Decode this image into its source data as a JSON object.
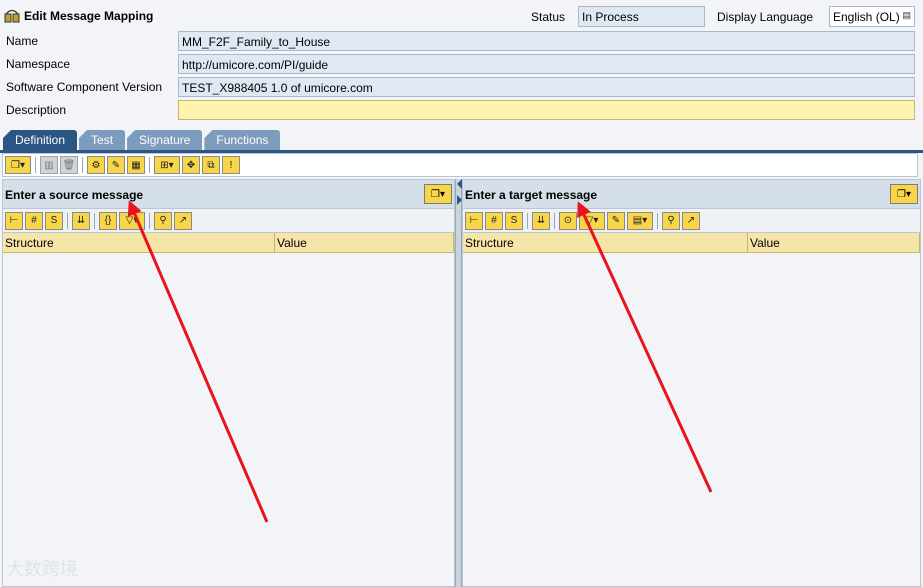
{
  "header": {
    "title": "Edit Message Mapping",
    "status_label": "Status",
    "status_value": "In Process",
    "language_label": "Display Language",
    "language_value": "English (OL)"
  },
  "fields": [
    {
      "label": "Name",
      "value": "MM_F2F_Family_to_House"
    },
    {
      "label": "Namespace",
      "value": "http://umicore.com/PI/guide"
    },
    {
      "label": "Software Component Version",
      "value": "TEST_X988405 1.0 of umicore.com"
    },
    {
      "label": "Description",
      "value": ""
    }
  ],
  "tabs": [
    {
      "label": "Definition",
      "active": true
    },
    {
      "label": "Test",
      "active": false
    },
    {
      "label": "Signature",
      "active": false
    },
    {
      "label": "Functions",
      "active": false
    }
  ],
  "source_pane": {
    "title": "Enter a source message",
    "columns": [
      "Structure",
      "Value"
    ]
  },
  "target_pane": {
    "title": "Enter a target message",
    "columns": [
      "Structure",
      "Value"
    ]
  },
  "watermark": "大数跨境",
  "colors": {
    "tab_active": "#2b5683",
    "tab_inactive": "#7d9bbc",
    "field_bg": "#dfe8f3",
    "required_field_bg": "#fff3b0",
    "table_header_bg": "#f5e6a8",
    "annotation_arrow": "#e8141b"
  }
}
